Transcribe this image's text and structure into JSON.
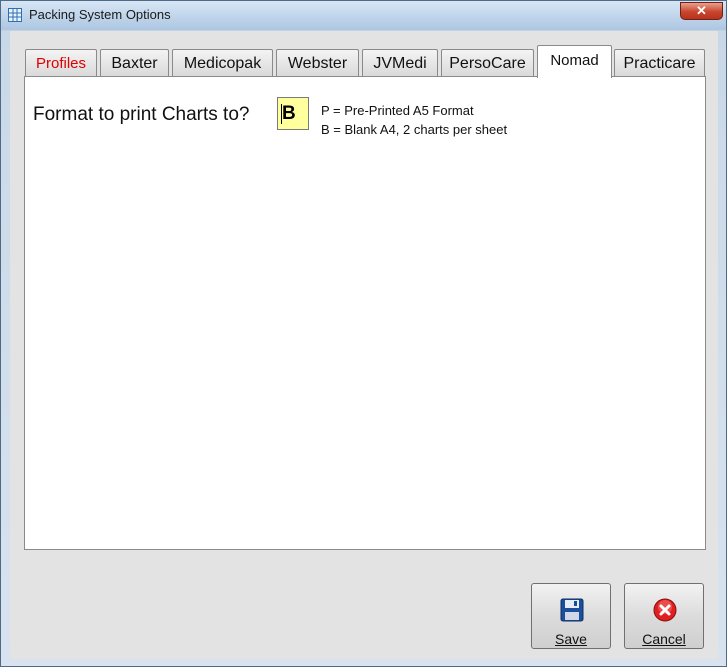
{
  "window": {
    "title": "Packing System Options",
    "close_glyph": "✕"
  },
  "tabs": [
    {
      "label": "Profiles",
      "color": "#e00000"
    },
    {
      "label": "Baxter"
    },
    {
      "label": "Medicopak"
    },
    {
      "label": "Webster"
    },
    {
      "label": "JVMedi"
    },
    {
      "label": "PersoCare"
    },
    {
      "label": "Nomad",
      "active": true
    },
    {
      "label": "Practicare"
    }
  ],
  "nomad": {
    "question": "Format to print Charts to?",
    "format_value": "B",
    "hints": [
      "P = Pre-Printed A5 Format",
      "B = Blank A4, 2 charts per sheet"
    ]
  },
  "buttons": {
    "save": {
      "label": "Save",
      "icon": "floppy-disk-icon"
    },
    "cancel": {
      "label": "Cancel",
      "icon": "cancel-x-icon"
    }
  },
  "colors": {
    "input_bg": "#ffff9e",
    "cancel_red": "#e02020",
    "save_blue": "#1b4f9c"
  }
}
